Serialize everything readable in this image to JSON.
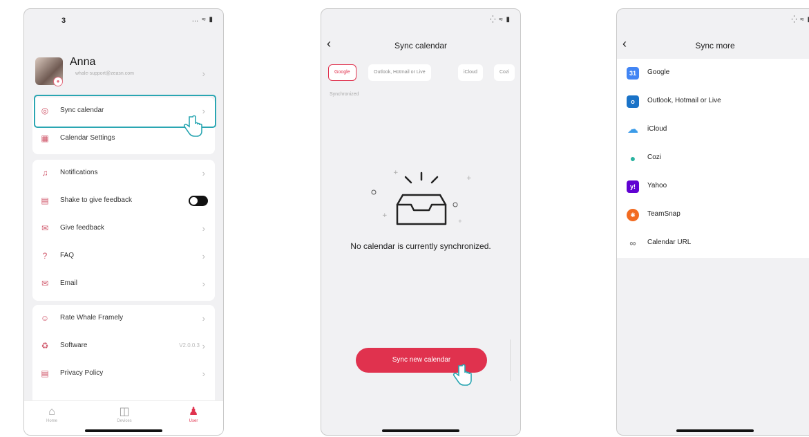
{
  "phone1": {
    "status": {
      "time": "3",
      "signal": "… ◉ ▮"
    },
    "profile": {
      "name": "Anna",
      "email": "whale-support@zeasn.com"
    },
    "group1": [
      {
        "label": "Sync calendar",
        "icon": "eye-icon"
      },
      {
        "label": "Calendar Settings",
        "icon": "calendar-settings-icon"
      }
    ],
    "group2": [
      {
        "label": "Notifications",
        "icon": "bell-icon"
      },
      {
        "label": "Shake to give feedback",
        "icon": "shake-icon"
      },
      {
        "label": "Give feedback",
        "icon": "mail-icon"
      },
      {
        "label": "FAQ",
        "icon": "question-icon"
      },
      {
        "label": "Email",
        "icon": "email-icon"
      }
    ],
    "group3": [
      {
        "label": "Rate Whale Framely",
        "icon": "smile-icon"
      },
      {
        "label": "Software",
        "icon": "software-icon",
        "version": "V2.0.0.3"
      },
      {
        "label": "Privacy Policy",
        "icon": "document-icon"
      }
    ],
    "tabs": [
      {
        "label": "Home",
        "icon": "home-icon"
      },
      {
        "label": "Devices",
        "icon": "devices-icon"
      },
      {
        "label": "User",
        "icon": "user-icon",
        "active": true
      }
    ]
  },
  "phone2": {
    "title": "Sync calendar",
    "chips": [
      "Google",
      "Outlook, Hotmail or Live",
      "iCloud",
      "Cozi"
    ],
    "selected_chip": "Google",
    "section_label": "Synchronized",
    "empty_message": "No calendar is currently synchronized.",
    "button": "Sync new calendar"
  },
  "phone3": {
    "title": "Sync more",
    "items": [
      {
        "label": "Google",
        "icon": "google-calendar-icon",
        "badge": "31",
        "color": "#4285f4"
      },
      {
        "label": "Outlook, Hotmail or Live",
        "icon": "outlook-icon",
        "badge": "o",
        "color": "#1a73c8"
      },
      {
        "label": "iCloud",
        "icon": "icloud-icon",
        "badge": "",
        "color": "#3b9be8"
      },
      {
        "label": "Cozi",
        "icon": "cozi-icon",
        "badge": "",
        "color": "#ffffff"
      },
      {
        "label": "Yahoo",
        "icon": "yahoo-icon",
        "badge": "y!",
        "color": "#6001d2"
      },
      {
        "label": "TeamSnap",
        "icon": "teamsnap-icon",
        "badge": "✱",
        "color": "#f26b21"
      },
      {
        "label": "Calendar URL",
        "icon": "link-icon",
        "badge": "",
        "color": "#ffffff"
      }
    ]
  },
  "colors": {
    "accent": "#e0324e",
    "highlight": "#2aa6b2"
  }
}
